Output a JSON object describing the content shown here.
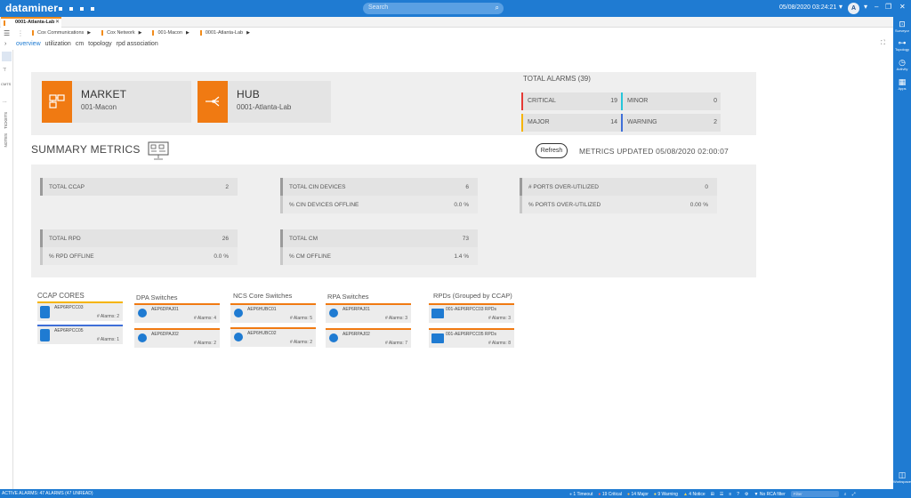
{
  "app": {
    "brand": "dataminer",
    "clock": "05/08/2020 03:24:21",
    "user_initial": "A",
    "search_placeholder": "Search"
  },
  "tab": {
    "label": "0001-Atlanta-Lab",
    "close": "✕"
  },
  "breadcrumb": [
    "Cox Communications",
    "Cox Network",
    "001-Macon",
    "0001-Atlanta-Lab"
  ],
  "subtabs": [
    "overview",
    "utilization",
    "cm",
    "topology",
    "rpd association"
  ],
  "left_rail": {
    "cmts": "CMTS",
    "tickets": "TICKETS",
    "notes": "NOTES"
  },
  "right_rail": [
    "Surveyor",
    "Topology",
    "Activity",
    "Apps",
    "Workspace"
  ],
  "market": {
    "title": "MARKET",
    "value": "001-Macon"
  },
  "hub": {
    "title": "HUB",
    "value": "0001-Atlanta-Lab"
  },
  "alarms": {
    "title": "TOTAL ALARMS (39)",
    "items": [
      {
        "name": "CRITICAL",
        "value": "19",
        "color": "#e53935"
      },
      {
        "name": "MINOR",
        "value": "0",
        "color": "#26c6da"
      },
      {
        "name": "MAJOR",
        "value": "14",
        "color": "#f5b400"
      },
      {
        "name": "WARNING",
        "value": "2",
        "color": "#3f6fd8"
      }
    ]
  },
  "summary": {
    "heading": "SUMMARY METRICS",
    "refresh": "Refresh",
    "updated": "METRICS UPDATED 05/08/2020 02:00:07"
  },
  "metrics": [
    {
      "name": "TOTAL CCAP",
      "value": "2"
    },
    {
      "name": "TOTAL CIN DEVICES",
      "value": "6"
    },
    {
      "name": "% CIN DEVICES OFFLINE",
      "value": "0.0 %"
    },
    {
      "name": "# PORTS OVER-UTILIZED",
      "value": "0"
    },
    {
      "name": "% PORTS OVER-UTILIZED",
      "value": "0.00 %"
    },
    {
      "name": "TOTAL RPD",
      "value": "26"
    },
    {
      "name": "% RPD OFFLINE",
      "value": "0.0 %"
    },
    {
      "name": "TOTAL CM",
      "value": "73"
    },
    {
      "name": "% CM OFFLINE",
      "value": "1.4 %"
    }
  ],
  "columns": {
    "ccap": {
      "title": "CCAP CORES",
      "items": [
        {
          "name": "AEP6RPCC03",
          "alarms": "# Alarms: 2",
          "color": "#f5b400"
        },
        {
          "name": "AEP6RPCC05",
          "alarms": "# Alarms: 1",
          "color": "#3f6fd8"
        }
      ]
    },
    "dpa": {
      "title": "DPA Switches",
      "items": [
        {
          "name": "AEP6DPAJ01",
          "alarms": "# Alarms: 4",
          "color": "#f07a12"
        },
        {
          "name": "AEP6DPAJ02",
          "alarms": "# Alarms: 2",
          "color": "#f07a12"
        }
      ]
    },
    "ncs": {
      "title": "NCS Core Switches",
      "items": [
        {
          "name": "AEP6HUBC01",
          "alarms": "# Alarms: 5",
          "color": "#f07a12"
        },
        {
          "name": "AEP6HUBC02",
          "alarms": "# Alarms: 2",
          "color": "#f07a12"
        }
      ]
    },
    "rpa": {
      "title": "RPA Switches",
      "items": [
        {
          "name": "AEP6RPAJ01",
          "alarms": "# Alarms: 3",
          "color": "#f07a12"
        },
        {
          "name": "AEP6RPAJ02",
          "alarms": "# Alarms: 7",
          "color": "#f07a12"
        }
      ]
    },
    "rpds": {
      "title": "RPDs (Grouped by CCAP)",
      "items": [
        {
          "name": "001-AEP6RPCC03 RPDs",
          "alarms": "# Alarms: 3",
          "color": "#f07a12"
        },
        {
          "name": "001-AEP6RPCC05 RPDs",
          "alarms": "# Alarms: 8",
          "color": "#f07a12"
        }
      ]
    }
  },
  "statusbar": {
    "left": "ACTIVE ALARMS: 47 ALARMS (47 UNREAD)",
    "timeout": "1 Timeout",
    "critical": "19 Critical",
    "major": "14 Major",
    "warning": "9 Warning",
    "notice": "4 Notice",
    "filter_label": "No RCA filter",
    "filter_placeholder": "Filter"
  }
}
